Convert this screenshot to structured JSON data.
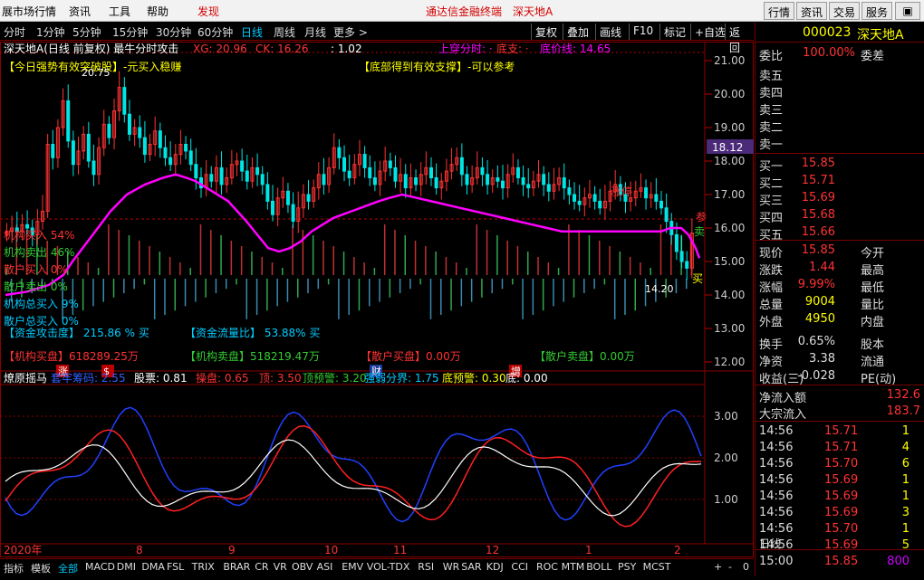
{
  "menubar": {
    "items": [
      "展市场行情",
      "资讯",
      "工具",
      "帮助",
      "发现"
    ],
    "center_title": "通达信金融终端",
    "stock_name_title": "深天地A",
    "right_buttons": [
      "行情",
      "资讯",
      "交易",
      "服务"
    ]
  },
  "periods": [
    "分时",
    "1分钟",
    "5分钟",
    "15分钟",
    "30分钟",
    "60分钟",
    "日线",
    "周线",
    "月线",
    "更多 >"
  ],
  "toolbar": [
    "复权",
    "叠加",
    "画线",
    "F10",
    "标记",
    "+自选",
    "返回"
  ],
  "main_header": {
    "title": "深天地A(日线 前复权) 最牛分时攻击",
    "xg": "XG: 20.96",
    "ck": "CK: 16.26",
    "ratio": ": 1.02",
    "up": "上穿分时: ·",
    "bottom": "底支: ·",
    "bottom_line": "底价线: 14.65"
  },
  "annotations": {
    "a1": "【今日强势有效突破股】-元买入稳赚",
    "a2": "【底部得到有效支撑】-可以参考",
    "high": "20.75",
    "low": "14.20",
    "price_tag": "18.12",
    "fund_attack": "【资金攻击度】 215.86 % 买",
    "fund_ratio": "【资金流量比】 53.88% 买",
    "inst_buy": "【机构买盘】618289.25万",
    "inst_sell": "【机构卖盘】518219.47万",
    "retail_buy": "【散户买盘】0.00万",
    "retail_sell": "【散户卖盘】0.00万",
    "left_stats": [
      "机构买入 54%",
      "机构卖出 46%",
      "散户买入 0%",
      "散户卖出 0%",
      "机构总买入 9%",
      "散户总买入 0%"
    ],
    "labels_bottom": [
      "涨",
      "$",
      "财",
      "增"
    ],
    "buy_marker": "买",
    "sell_marker": "卖",
    "can_marker": "参",
    "stop": "涨停"
  },
  "price_axis": [
    "21.00",
    "20.00",
    "19.00",
    "18.00",
    "17.00",
    "16.00",
    "15.00",
    "14.00",
    "13.00",
    "12.00"
  ],
  "sub_header": {
    "name": "燎原摇马",
    "fields": [
      "套牢筹码: 2.55",
      "股票: 0.81",
      "操盘: 0.65",
      "顶: 3.50",
      "顶预警: 3.20",
      "强弱分界: 1.75",
      "底预警: 0.30",
      "底: 0.00"
    ]
  },
  "sub_axis": [
    "3.00",
    "2.00",
    "1.00"
  ],
  "x_labels": [
    "2020年",
    "8",
    "9",
    "10",
    "11",
    "12",
    "1",
    "2"
  ],
  "bottom_tabs": [
    "指标",
    "模板",
    "全部",
    "MACD",
    "DMI",
    "DMA",
    "FSL",
    "TRIX",
    "BRAR",
    "CR",
    "VR",
    "OBV",
    "ASI",
    "EMV",
    "VOL-TDX",
    "RSI",
    "WR",
    "SAR",
    "KDJ",
    "CCI",
    "ROC",
    "MTM",
    "BOLL",
    "PSY",
    "MCST"
  ],
  "bottom_right": [
    "+",
    "-",
    "0"
  ],
  "period_right": "日线",
  "quote": {
    "code": "000023",
    "name": "深天地A",
    "wb_label": "委比",
    "wb": "100.00%",
    "wc_label": "委差",
    "sell": [
      "卖五",
      "卖四",
      "卖三",
      "卖二",
      "卖一"
    ],
    "buy": [
      [
        "买一",
        "15.85"
      ],
      [
        "买二",
        "15.71"
      ],
      [
        "买三",
        "15.69"
      ],
      [
        "买四",
        "15.68"
      ],
      [
        "买五",
        "15.66"
      ]
    ],
    "stats": [
      [
        "现价",
        "15.85",
        "今开"
      ],
      [
        "涨跌",
        "1.44",
        "最高"
      ],
      [
        "涨幅",
        "9.99%",
        "最低"
      ],
      [
        "总量",
        "9004",
        "量比"
      ],
      [
        "外盘",
        "4950",
        "内盘"
      ],
      [
        "换手",
        "0.65%",
        "股本"
      ],
      [
        "净资",
        "3.38",
        "流通"
      ],
      [
        "收益(三)",
        "-0.028",
        "PE(动)"
      ]
    ],
    "flow": [
      [
        "净流入额",
        "132.6"
      ],
      [
        "大宗流入",
        "183.7"
      ]
    ],
    "ticks": [
      [
        "14:56",
        "15.71",
        "1"
      ],
      [
        "14:56",
        "15.71",
        "4"
      ],
      [
        "14:56",
        "15.70",
        "6"
      ],
      [
        "14:56",
        "15.69",
        "1"
      ],
      [
        "14:56",
        "15.69",
        "1"
      ],
      [
        "14:56",
        "15.69",
        "3"
      ],
      [
        "14:56",
        "15.70",
        "1"
      ],
      [
        "14:56",
        "15.69",
        "5"
      ],
      [
        "15:00",
        "15.85",
        "800"
      ]
    ]
  },
  "colors": {
    "up": "#ff3333",
    "down": "#00e5e5",
    "ma": "#ff00ff",
    "grid": "#8b0000"
  }
}
